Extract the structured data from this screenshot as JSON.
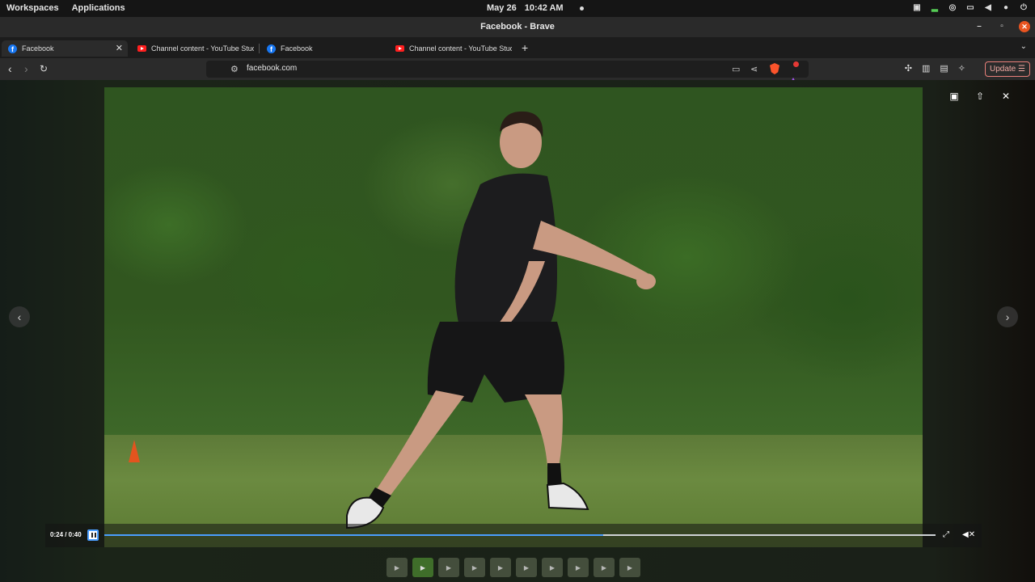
{
  "system_bar": {
    "workspaces": "Workspaces",
    "applications": "Applications",
    "date": "May 26",
    "time": "10:42 AM"
  },
  "window": {
    "title": "Facebook - Brave"
  },
  "tabs": [
    {
      "label": "Facebook",
      "icon": "facebook-icon",
      "active": true
    },
    {
      "label": "Channel content - YouTube Stud",
      "icon": "youtube-icon",
      "active": false
    },
    {
      "label": "Facebook",
      "icon": "facebook-icon",
      "active": false
    },
    {
      "label": "Channel content - YouTube Stud",
      "icon": "youtube-icon",
      "active": false
    }
  ],
  "address_bar": {
    "url": "facebook.com"
  },
  "toolbar": {
    "update_label": "Update"
  },
  "player": {
    "current_time": "0:24",
    "duration": "0:40",
    "time_display": "0:24 / 0:40",
    "progress": 0.6
  },
  "thumbnails": {
    "count": 10,
    "active_index": 1
  },
  "colors": {
    "accent": "#4a9eff",
    "close": "#e95420",
    "brave": "#fb542b"
  }
}
